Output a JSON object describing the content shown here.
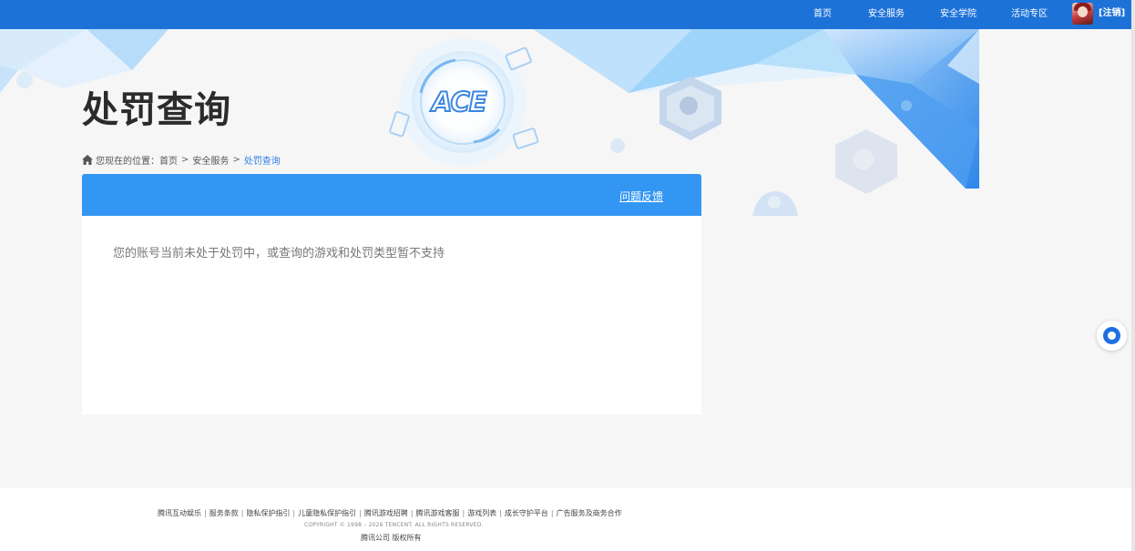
{
  "nav": {
    "items": [
      {
        "label": "首页"
      },
      {
        "label": "安全服务"
      },
      {
        "label": "安全学院"
      },
      {
        "label": "活动专区"
      }
    ],
    "logout": "[注销]",
    "color": "#1d72d8"
  },
  "hero": {
    "title": "处罚查询",
    "logo_text": "ACE"
  },
  "breadcrumb": {
    "prefix": "您现在的位置：",
    "home": "首页",
    "separator": ">",
    "section": "安全服务",
    "current": "处罚查询"
  },
  "card": {
    "feedback_label": "问题反馈",
    "message": "您的账号当前未处于处罚中，或查询的游戏和处罚类型暂不支持",
    "header_color": "#3396f2"
  },
  "footer": {
    "links": [
      "腾讯互动娱乐",
      "服务条款",
      "隐私保护指引",
      "儿童隐私保护指引",
      "腾讯游戏招聘",
      "腾讯游戏客服",
      "游戏列表",
      "成长守护平台",
      "广告服务及商务合作"
    ],
    "link_separator": "|",
    "copyright": "COPYRIGHT © 1998 – 2026 TENCENT. ALL RIGHTS RESERVED.",
    "owner": "腾讯公司 版权所有"
  }
}
